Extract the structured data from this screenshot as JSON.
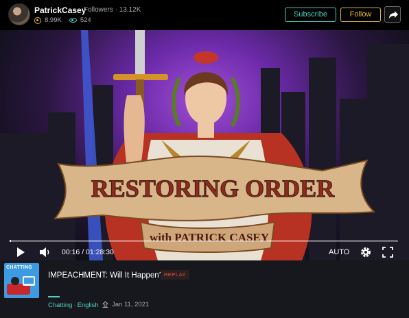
{
  "channel": {
    "name": "PatrickCasey",
    "followers_label": "Followers · 13.12K",
    "coins": "8.99K",
    "views": "524",
    "subscribe_label": "Subscribe",
    "follow_label": "Follow",
    "accent": "#4fd0c2",
    "follow_color": "#e8b931"
  },
  "video": {
    "art_title_line1": "RESTORING ORDER",
    "art_title_line2": "with PATRICK CASEY",
    "time": "00:16 / 01:28:30",
    "quality": "AUTO",
    "progress": 0.003
  },
  "info": {
    "thumb_label": "CHATTING",
    "title": "IMPEACHMENT: Will It Happen?",
    "badge": "REPLAY",
    "category": "Chatting",
    "language": "English",
    "date": "Jan 11, 2021"
  }
}
